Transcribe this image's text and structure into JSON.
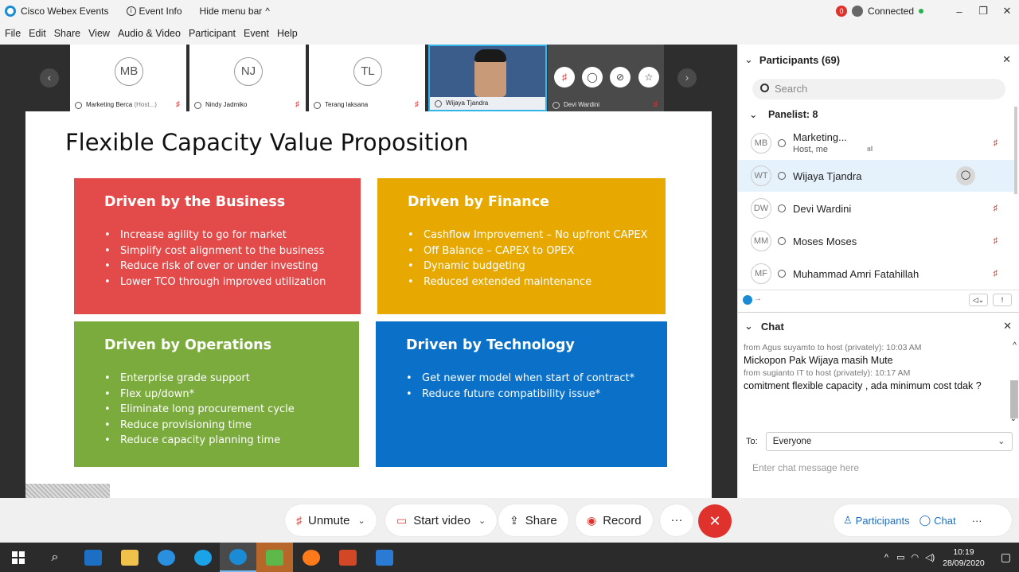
{
  "titlebar": {
    "app_name": "Cisco Webex Events",
    "event_info": "Event Info",
    "hide_menu": "Hide menu bar",
    "hide_menu_caret": "^",
    "rec_count": "0",
    "connection_status": "Connected",
    "minimize": "–",
    "restore": "❐",
    "close": "✕"
  },
  "menu": [
    "File",
    "Edit",
    "Share",
    "View",
    "Audio & Video",
    "Participant",
    "Event",
    "Help"
  ],
  "strip": {
    "prev": "‹",
    "next": "›",
    "tiles": [
      {
        "initials": "MB",
        "name": "Marketing Berca",
        "suffix": "(Host...)",
        "mute": "♯"
      },
      {
        "initials": "NJ",
        "name": "Nindy Jadmiko",
        "mute": "♯"
      },
      {
        "initials": "TL",
        "name": "Terang laksana",
        "mute": "♯"
      },
      {
        "name": "Wijaya Tjandra"
      },
      {
        "name": "Devi Wardini",
        "mute": "♯"
      }
    ],
    "tile_controls": [
      "♯",
      "◯",
      "⊘",
      "☆"
    ]
  },
  "slide": {
    "title": "Flexible Capacity Value Proposition",
    "boxes": [
      {
        "heading": "Driven by the Business",
        "bullets": [
          "Increase agility to go for market",
          "Simplify cost alignment to the business",
          "Reduce risk of over or under investing",
          "Lower TCO through improved utilization"
        ]
      },
      {
        "heading": "Driven by Finance",
        "bullets": [
          "Cashflow Improvement – No upfront CAPEX",
          "Off Balance – CAPEX to OPEX",
          "Dynamic budgeting",
          "Reduced extended maintenance"
        ]
      },
      {
        "heading": "Driven by Operations",
        "bullets": [
          "Enterprise grade support",
          "Flex up/down*",
          "Eliminate long procurement cycle",
          "Reduce provisioning time",
          "Reduce capacity planning time"
        ]
      },
      {
        "heading": "Driven by Technology",
        "bullets": [
          "Get newer model when start of contract*",
          "Reduce future compatibility issue*"
        ]
      }
    ]
  },
  "participants": {
    "title": "Participants (69)",
    "search_placeholder": "Search",
    "panelist_header": "Panelist: 8",
    "rows": [
      {
        "initials": "MB",
        "name": "Marketing...",
        "sub": "Host, me",
        "bars": "ııl",
        "mute": "♯"
      },
      {
        "initials": "WT",
        "name": "Wijaya Tjandra",
        "chat_icon": "◯"
      },
      {
        "initials": "DW",
        "name": "Devi Wardini",
        "mute": "♯"
      },
      {
        "initials": "MM",
        "name": "Moses Moses",
        "mute": "♯"
      },
      {
        "initials": "MF",
        "name": "Muhammad Amri Fatahillah",
        "mute": "♯"
      }
    ],
    "toolbar_left": "→",
    "toolbar_buttons": [
      "◁⌄",
      "!"
    ]
  },
  "chat": {
    "title": "Chat",
    "messages": [
      {
        "meta": "from Agus suyamto to host (privately):    10:03 AM",
        "text": "Mickopon Pak Wijaya masih Mute"
      },
      {
        "meta": "from sugianto IT to host (privately):    10:17 AM",
        "text": "comitment flexible capacity  , ada minimum cost tdak ?"
      }
    ],
    "to_label": "To:",
    "to_value": "Everyone",
    "input_placeholder": "Enter chat message here",
    "scroll_up": "^",
    "scroll_down": "⌄"
  },
  "controls": {
    "unmute": "Unmute",
    "start_video": "Start video",
    "share": "Share",
    "record": "Record",
    "more": "···",
    "end": "✕",
    "participants": "Participants",
    "chat": "Chat",
    "more_right": "···"
  },
  "taskbar": {
    "time": "10:19",
    "date": "28/09/2020",
    "tray_up": "^"
  },
  "colors": {
    "business": "#e34b4b",
    "finance": "#e6a801",
    "operations": "#7aab3c",
    "technology": "#0a70c8",
    "end_call": "#e0322d",
    "accent": "#1c6fc4"
  }
}
